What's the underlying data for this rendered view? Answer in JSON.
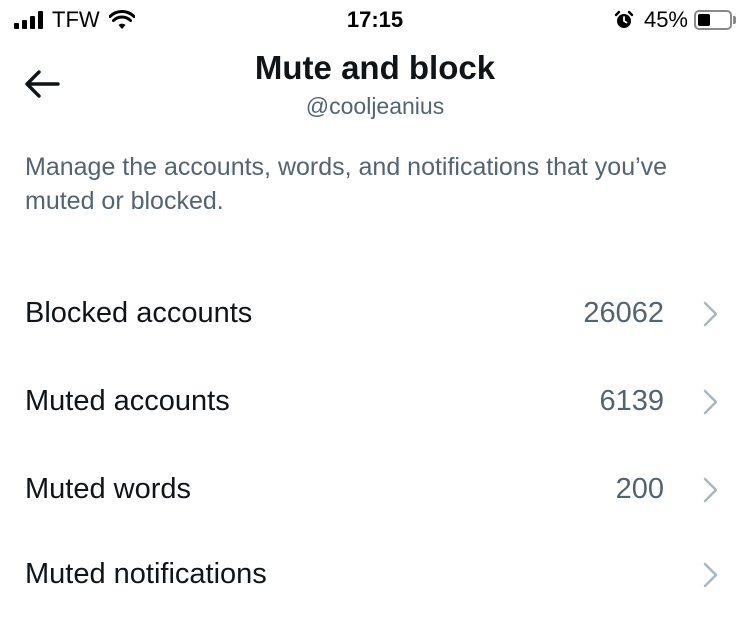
{
  "status_bar": {
    "carrier": "TFW",
    "time": "17:15",
    "battery_percent": "45%",
    "battery_level": 0.45,
    "icons": [
      "signal-icon",
      "wifi-icon",
      "alarm-icon",
      "battery-icon"
    ]
  },
  "header": {
    "title": "Mute and block",
    "handle": "@cooljeanius",
    "back_icon": "back-arrow-icon"
  },
  "description": "Manage the accounts, words, and notifications that you’ve muted or blocked.",
  "items": [
    {
      "label": "Blocked accounts",
      "count": "26062"
    },
    {
      "label": "Muted accounts",
      "count": "6139"
    },
    {
      "label": "Muted words",
      "count": "200"
    },
    {
      "label": "Muted notifications",
      "count": ""
    }
  ],
  "colors": {
    "primary_text": "#0f1419",
    "secondary_text": "#536471",
    "chevron": "#aab8c2",
    "background": "#ffffff"
  }
}
